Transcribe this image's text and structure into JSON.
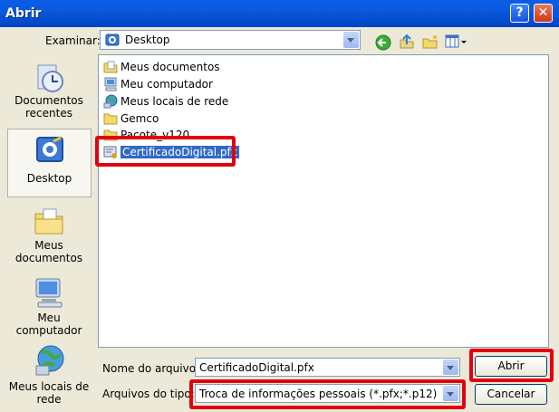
{
  "window": {
    "title": "Abrir",
    "help_glyph": "?",
    "close_glyph": "✕"
  },
  "toolbar": {
    "lookin_label": "Examinar:",
    "lookin_value": "Desktop",
    "icons": [
      "back-icon",
      "up-folder-icon",
      "new-folder-icon",
      "views-menu-icon"
    ]
  },
  "places": [
    {
      "id": "recent",
      "label": "Documentos recentes",
      "icon": "recent-documents-icon"
    },
    {
      "id": "desktop",
      "label": "Desktop",
      "icon": "desktop-icon",
      "selected": true
    },
    {
      "id": "documents",
      "label": "Meus documentos",
      "icon": "my-documents-icon"
    },
    {
      "id": "computer",
      "label": "Meu computador",
      "icon": "my-computer-icon"
    },
    {
      "id": "network",
      "label": "Meus locais de rede",
      "icon": "network-places-icon"
    }
  ],
  "files": [
    {
      "name": "Meus documentos",
      "icon": "documents-folder-icon"
    },
    {
      "name": "Meu computador",
      "icon": "computer-icon"
    },
    {
      "name": "Meus locais de rede",
      "icon": "network-icon"
    },
    {
      "name": "Gemco",
      "icon": "folder-icon"
    },
    {
      "name": "Pacote_v120",
      "icon": "folder-icon"
    },
    {
      "name": "CertificadoDigital.pfx",
      "icon": "certificate-file-icon",
      "selected": true
    }
  ],
  "form": {
    "filename_label": "Nome do arquivo:",
    "filename_value": "CertificadoDigital.pfx",
    "filetype_label": "Arquivos do tipo:",
    "filetype_value": "Troca de informações pessoais (*.pfx;*.p12)"
  },
  "buttons": {
    "open": "Abrir",
    "cancel": "Cancelar"
  },
  "colors": {
    "highlight_box": "#e2000f",
    "selection": "#316ac5",
    "titlebar": "#0a5de6"
  }
}
